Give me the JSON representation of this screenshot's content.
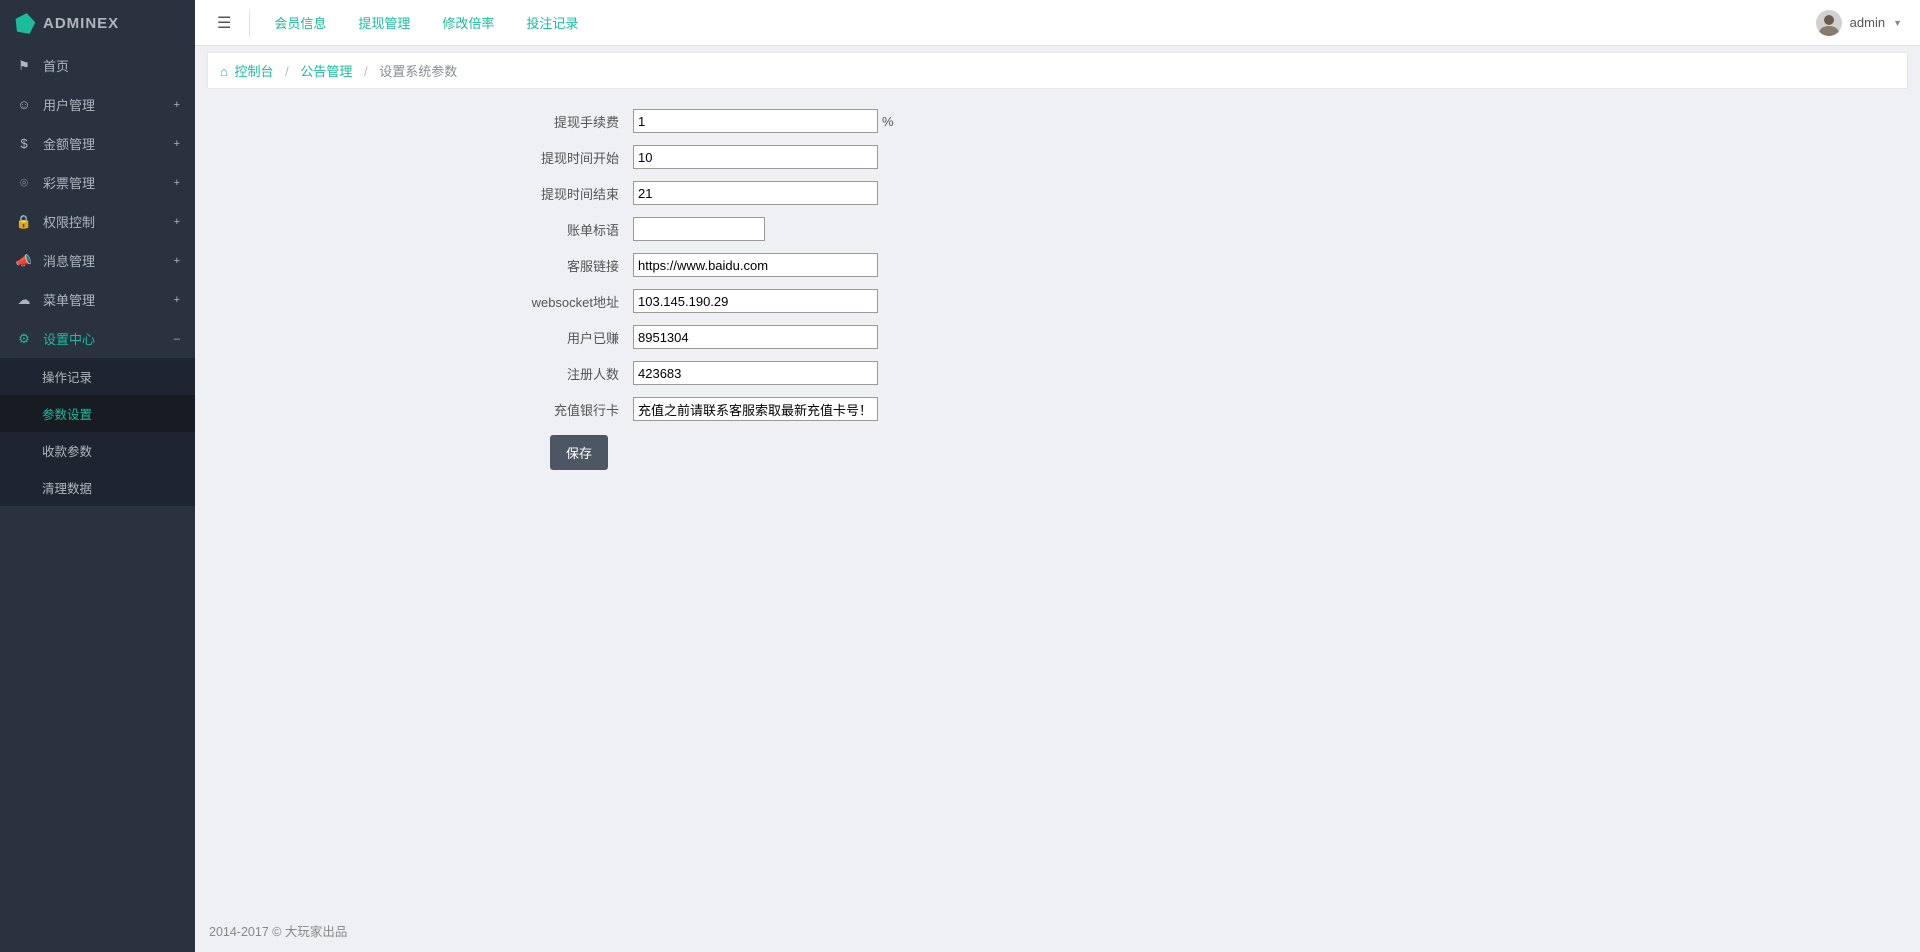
{
  "brand": {
    "text_main": "ADMIN",
    "text_suffix": "EX"
  },
  "top_nav": {
    "links": [
      "会员信息",
      "提现管理",
      "修改倍率",
      "投注记录"
    ],
    "user_name": "admin"
  },
  "sidebar": {
    "items": [
      {
        "icon": "⚑",
        "label": "首页"
      },
      {
        "icon": "☺",
        "label": "用户管理",
        "toggle": "+"
      },
      {
        "icon": "$",
        "label": "金额管理",
        "toggle": "+"
      },
      {
        "icon": "⌾",
        "label": "彩票管理",
        "toggle": "+"
      },
      {
        "icon": "🔒",
        "label": "权限控制",
        "toggle": "+"
      },
      {
        "icon": "📣",
        "label": "消息管理",
        "toggle": "+"
      },
      {
        "icon": "☁",
        "label": "菜单管理",
        "toggle": "+"
      },
      {
        "icon": "⚙",
        "label": "设置中心",
        "toggle": "–"
      }
    ],
    "submenu": {
      "op_log": "操作记录",
      "params": "参数设置",
      "pay_params": "收款参数",
      "clear_data": "清理数据"
    }
  },
  "breadcrumb": {
    "home": "控制台",
    "mid": "公告管理",
    "current": "设置系统参数"
  },
  "form": {
    "withdraw_fee": {
      "label": "提现手续费",
      "value": "1",
      "suffix": "%"
    },
    "withdraw_start": {
      "label": "提现时间开始",
      "value": "10"
    },
    "withdraw_end": {
      "label": "提现时间结束",
      "value": "21"
    },
    "bill_slogan": {
      "label": "账单标语",
      "value": ""
    },
    "service_link": {
      "label": "客服链接",
      "value": "https://www.baidu.com"
    },
    "websocket": {
      "label": "websocket地址",
      "value": "103.145.190.29"
    },
    "user_earned": {
      "label": "用户已赚",
      "value": "8951304"
    },
    "register_count": {
      "label": "注册人数",
      "value": "423683"
    },
    "recharge_bank": {
      "label": "充值银行卡",
      "value": "充值之前请联系客服索取最新充值卡号！"
    },
    "save_btn": "保存"
  },
  "footer": {
    "text": "2014-2017 © 大玩家出品"
  }
}
